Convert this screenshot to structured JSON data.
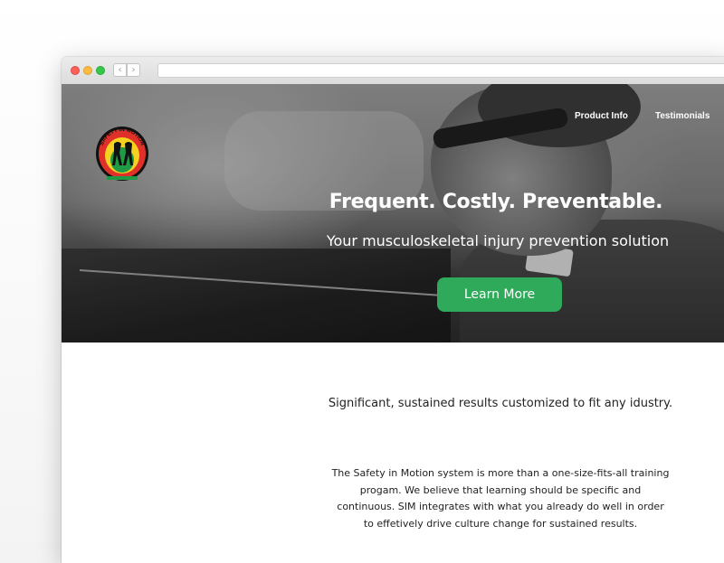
{
  "browser": {
    "back_glyph": "‹",
    "forward_glyph": "›",
    "address_value": ""
  },
  "nav": {
    "items": [
      {
        "label": "Product Info"
      },
      {
        "label": "Testimonials"
      }
    ]
  },
  "logo": {
    "text": "SAFETY IN MOTION",
    "colors": {
      "red": "#e0302a",
      "yellow": "#f4d21f",
      "green": "#1f9a45",
      "black": "#111111"
    }
  },
  "hero": {
    "headline": "Frequent. Costly. Preventable.",
    "subheadline": "Your musculoskeletal injury prevention solution",
    "cta_label": "Learn More",
    "cta_color": "#2faa5a"
  },
  "content": {
    "tagline": "Significant, sustained results customized to fit any idustry.",
    "description_lines": [
      "The Safety in Motion system is more than a one-size-fits-all training",
      "progam. We believe that learning should be specific and",
      "continuous. SIM integrates with what you already do well in order",
      "to effetively drive culture change for sustained results."
    ]
  }
}
